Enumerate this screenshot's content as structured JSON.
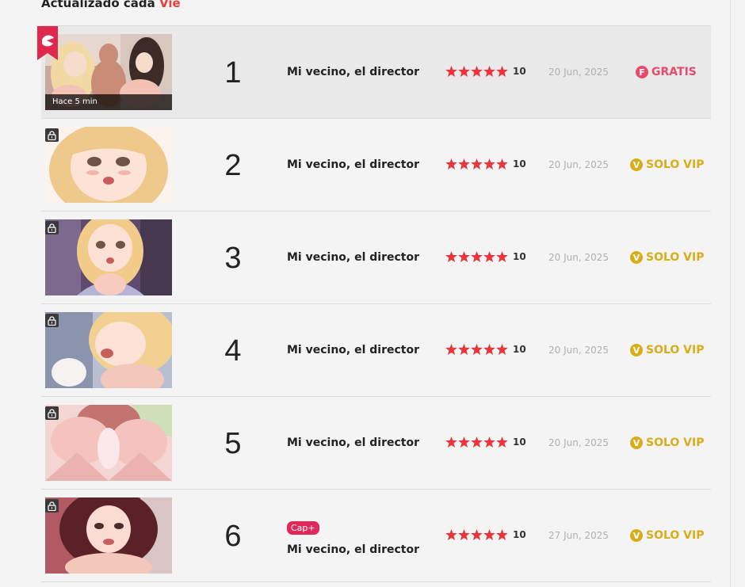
{
  "header": {
    "prefix": "Actualizado cada",
    "day": "Vie"
  },
  "accent_color": "#e8403b",
  "free_color": "#e94a6b",
  "vip_color": "#d9ad1a",
  "rows": [
    {
      "rank": "1",
      "title": "Mi vecino, el director",
      "score": "10",
      "date": "20 Jun, 2025",
      "status_letter": "F",
      "status": "GRATIS",
      "badge": "",
      "ago": "Hace 5 min",
      "rating_stars": 5,
      "icon": "hot-flag-icon"
    },
    {
      "rank": "2",
      "title": "Mi vecino, el director",
      "score": "10",
      "date": "20 Jun, 2025",
      "status_letter": "V",
      "status": "SOLO VIP",
      "badge": "",
      "ago": "",
      "rating_stars": 5,
      "icon": "lock-icon"
    },
    {
      "rank": "3",
      "title": "Mi vecino, el director",
      "score": "10",
      "date": "20 Jun, 2025",
      "status_letter": "V",
      "status": "SOLO VIP",
      "badge": "",
      "ago": "",
      "rating_stars": 5,
      "icon": "lock-icon"
    },
    {
      "rank": "4",
      "title": "Mi vecino, el director",
      "score": "10",
      "date": "20 Jun, 2025",
      "status_letter": "V",
      "status": "SOLO VIP",
      "badge": "",
      "ago": "",
      "rating_stars": 5,
      "icon": "lock-icon"
    },
    {
      "rank": "5",
      "title": "Mi vecino, el director",
      "score": "10",
      "date": "20 Jun, 2025",
      "status_letter": "V",
      "status": "SOLO VIP",
      "badge": "",
      "ago": "",
      "rating_stars": 5,
      "icon": "lock-icon"
    },
    {
      "rank": "6",
      "title": "Mi vecino, el director",
      "score": "10",
      "date": "27 Jun, 2025",
      "status_letter": "V",
      "status": "SOLO VIP",
      "badge": "Cap+",
      "ago": "",
      "rating_stars": 5,
      "icon": "lock-icon"
    }
  ]
}
